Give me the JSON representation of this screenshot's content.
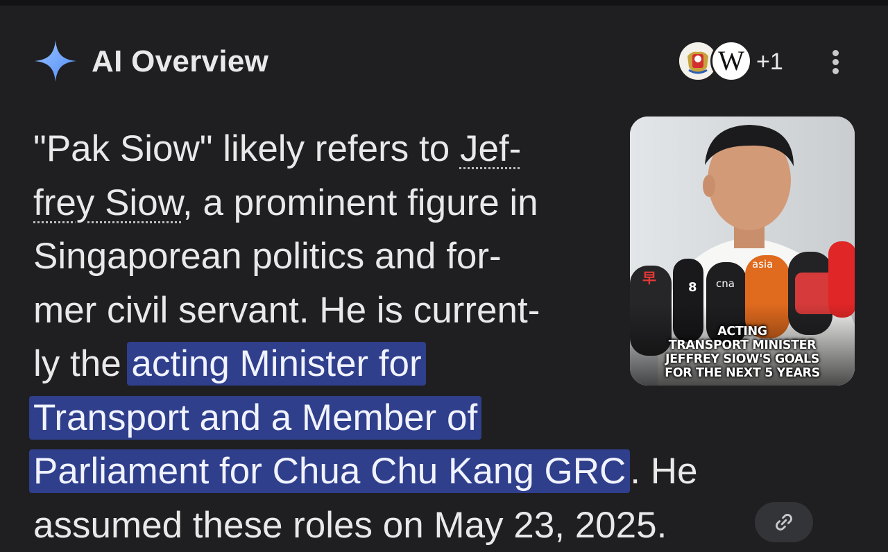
{
  "header": {
    "title": "AI Overview",
    "sparkle_icon": "sparkle-icon",
    "sources": [
      {
        "name": "singapore-government-crest-icon",
        "type": "source-favicon"
      },
      {
        "name": "wikipedia-icon",
        "glyph": "W",
        "type": "source-favicon"
      }
    ],
    "more_sources_label": "+1",
    "menu_icon": "more-vert-icon"
  },
  "overview": {
    "lines": [
      {
        "pre": "\"Pak Siow\" likely refers to ",
        "entity": "Jef-"
      },
      {
        "entity": "frey Siow",
        "post": ", a prominent figure in"
      },
      {
        "text": "Singaporean politics and for-"
      },
      {
        "text": "mer civil servant. He is current-"
      },
      {
        "pre": "ly the ",
        "highlight": "acting Minister for"
      },
      {
        "highlight": "Transport and a Member of"
      },
      {
        "highlight": "Parliament for Chua Chu Kang GRC",
        "post": ". He"
      },
      {
        "text": "assumed these roles on May 23, 2025."
      }
    ],
    "link_icon": "link-icon"
  },
  "thumbnail": {
    "caption_lines": [
      "ACTING",
      "TRANSPORT MINISTER",
      "JEFFREY SIOW'S GOALS",
      "FOR THE NEXT 5 YEARS"
    ],
    "mic_logos": [
      "早",
      "8",
      "cna",
      "asia"
    ]
  },
  "colors": {
    "background": "#1f1f21",
    "text": "#e9e9ea",
    "highlight": "#2f3f8b",
    "sparkle": "#7fb0ff"
  }
}
